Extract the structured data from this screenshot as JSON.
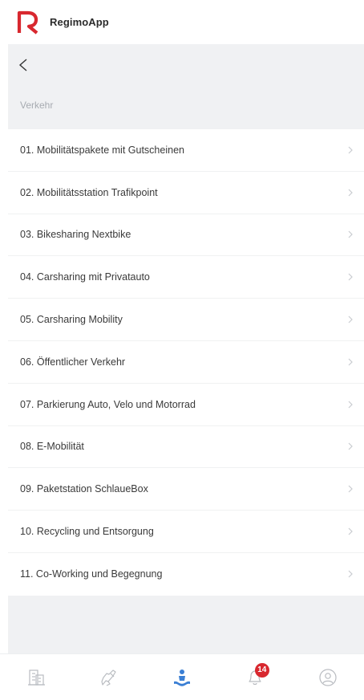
{
  "app": {
    "name": "RegimoApp",
    "brand_color": "#d8282f"
  },
  "nav": {
    "back_icon": "chevron-left-icon"
  },
  "section": {
    "title": "Verkehr"
  },
  "menu": {
    "items": [
      {
        "label": "01. Mobilitätspakete mit Gutscheinen"
      },
      {
        "label": "02. Mobilitätsstation Trafikpoint"
      },
      {
        "label": "03. Bikesharing Nextbike"
      },
      {
        "label": "04. Carsharing mit Privatauto"
      },
      {
        "label": "05. Carsharing Mobility"
      },
      {
        "label": "06. Öffentlicher Verkehr"
      },
      {
        "label": "07. Parkierung Auto, Velo und Motorrad"
      },
      {
        "label": "08. E-Mobilität"
      },
      {
        "label": "09. Paketstation SchlaueBox"
      },
      {
        "label": "10. Recycling und Entsorgung"
      },
      {
        "label": "11. Co-Working und Begegnung"
      }
    ]
  },
  "tabbar": {
    "tabs": [
      {
        "icon": "buildings-icon",
        "active": false
      },
      {
        "icon": "handshake-icon",
        "active": false
      },
      {
        "icon": "community-icon",
        "active": true
      },
      {
        "icon": "bell-icon",
        "active": false,
        "badge": "14"
      },
      {
        "icon": "profile-icon",
        "active": false
      }
    ],
    "active_color": "#3b7fd4",
    "inactive_color": "#b9bcc1"
  }
}
